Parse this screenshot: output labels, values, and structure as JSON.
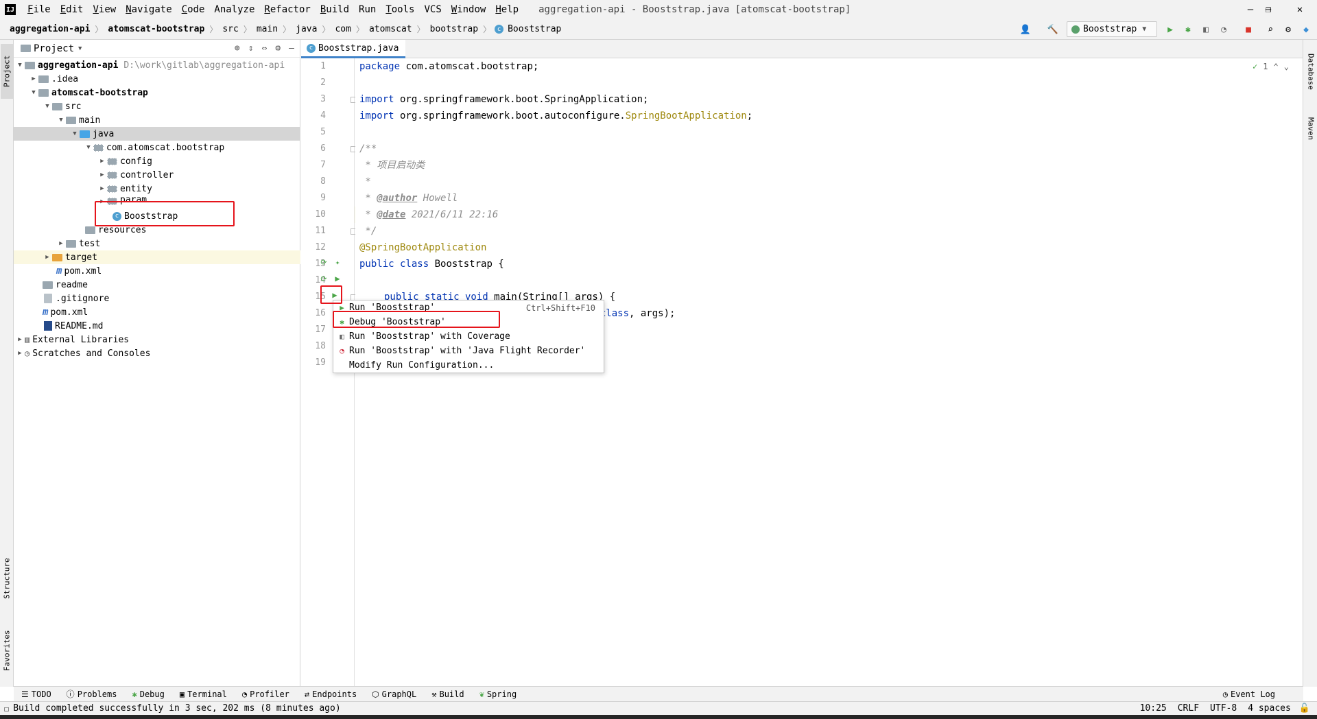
{
  "menubar": {
    "items": [
      {
        "mnemonic": "F",
        "rest": "ile"
      },
      {
        "mnemonic": "E",
        "rest": "dit"
      },
      {
        "mnemonic": "V",
        "rest": "iew"
      },
      {
        "mnemonic": "N",
        "rest": "avigate"
      },
      {
        "mnemonic": "C",
        "rest": "ode"
      },
      {
        "mnemonic": "",
        "rest": "Analyze"
      },
      {
        "mnemonic": "R",
        "rest": "efactor"
      },
      {
        "mnemonic": "B",
        "rest": "uild"
      },
      {
        "mnemonic": "",
        "rest": "Run"
      },
      {
        "mnemonic": "T",
        "rest": "ools"
      },
      {
        "mnemonic": "",
        "rest": "VCS"
      },
      {
        "mnemonic": "W",
        "rest": "indow"
      },
      {
        "mnemonic": "H",
        "rest": "elp"
      }
    ],
    "window_title": "aggregation-api - Booststrap.java [atomscat-bootstrap]"
  },
  "breadcrumbs": [
    "aggregation-api",
    "atomscat-bootstrap",
    "src",
    "main",
    "java",
    "com",
    "atomscat",
    "bootstrap",
    "Booststrap"
  ],
  "run_config": {
    "name": "Booststrap"
  },
  "left_strip": {
    "project": "Project",
    "structure": "Structure",
    "favorites": "Favorites"
  },
  "right_strip": {
    "database": "Database",
    "maven": "Maven"
  },
  "project_panel": {
    "title": "Project",
    "tree": [
      {
        "label": "aggregation-api",
        "hint": "D:\\work\\gitlab\\aggregation-api",
        "bold": true
      },
      {
        "label": ".idea"
      },
      {
        "label": "atomscat-bootstrap",
        "bold": true
      },
      {
        "label": "src"
      },
      {
        "label": "main"
      },
      {
        "label": "java"
      },
      {
        "label": "com.atomscat.bootstrap"
      },
      {
        "label": "config"
      },
      {
        "label": "controller"
      },
      {
        "label": "entity"
      },
      {
        "label": "param"
      },
      {
        "label": "Booststrap"
      },
      {
        "label": "resources"
      },
      {
        "label": "test"
      },
      {
        "label": "target"
      },
      {
        "label": "pom.xml"
      },
      {
        "label": "readme"
      },
      {
        "label": ".gitignore"
      },
      {
        "label": "pom.xml"
      },
      {
        "label": "README.md"
      },
      {
        "label": "External Libraries"
      },
      {
        "label": "Scratches and Consoles"
      }
    ]
  },
  "editor": {
    "tab_label": "Booststrap.java",
    "line_numbers": [
      "1",
      "2",
      "3",
      "4",
      "5",
      "6",
      "7",
      "8",
      "9",
      "10",
      "11",
      "12",
      "13",
      "14",
      "15",
      "16",
      "17",
      "18",
      "19"
    ],
    "code": {
      "l1_kw": "package",
      "l1_rest": " com.atomscat.bootstrap;",
      "l3_kw": "import",
      "l3_rest": " org.springframework.boot.SpringApplication;",
      "l4_kw": "import",
      "l4_rest": " org.springframework.boot.autoconfigure.",
      "l4_anno": "SpringBootApplication",
      "l4_end": ";",
      "l6": "/**",
      "l7": " * 项目启动类",
      "l8": " *",
      "l9_pre": " * ",
      "l9_tag": "@author",
      "l9_val": " Howell",
      "l10_pre": " * ",
      "l10_tag": "@date",
      "l10_val": " 2021/6/11 22:16",
      "l11": " */",
      "l12": "@SpringBootApplication",
      "l13_kw": "public class",
      "l13_rest": " Booststrap {",
      "l15_kw": "public static void",
      "l15_rest": " main(String[] args) {",
      "l16_kw": "p.class",
      "l16_rest": ", args);"
    },
    "inspection": {
      "count": "1"
    }
  },
  "run_popup": {
    "items": [
      {
        "label": "Run 'Booststrap'",
        "shortcut": "Ctrl+Shift+F10"
      },
      {
        "label": "Debug 'Booststrap'",
        "shortcut": ""
      },
      {
        "label": "Run 'Booststrap' with Coverage",
        "shortcut": ""
      },
      {
        "label": "Run 'Booststrap' with 'Java Flight Recorder'",
        "shortcut": ""
      },
      {
        "label": "Modify Run Configuration...",
        "shortcut": ""
      }
    ]
  },
  "bottom_tools": [
    "TODO",
    "Problems",
    "Debug",
    "Terminal",
    "Profiler",
    "Endpoints",
    "GraphQL",
    "Build",
    "Spring"
  ],
  "event_log": "Event Log",
  "status": {
    "message": "Build completed successfully in 3 sec, 202 ms (8 minutes ago)",
    "position": "10:25",
    "line_sep": "CRLF",
    "encoding": "UTF-8",
    "indent": "4 spaces"
  },
  "colors": {
    "accent": "#4083c9",
    "highlight_box": "#e5141b",
    "run_green": "#4aa547"
  }
}
